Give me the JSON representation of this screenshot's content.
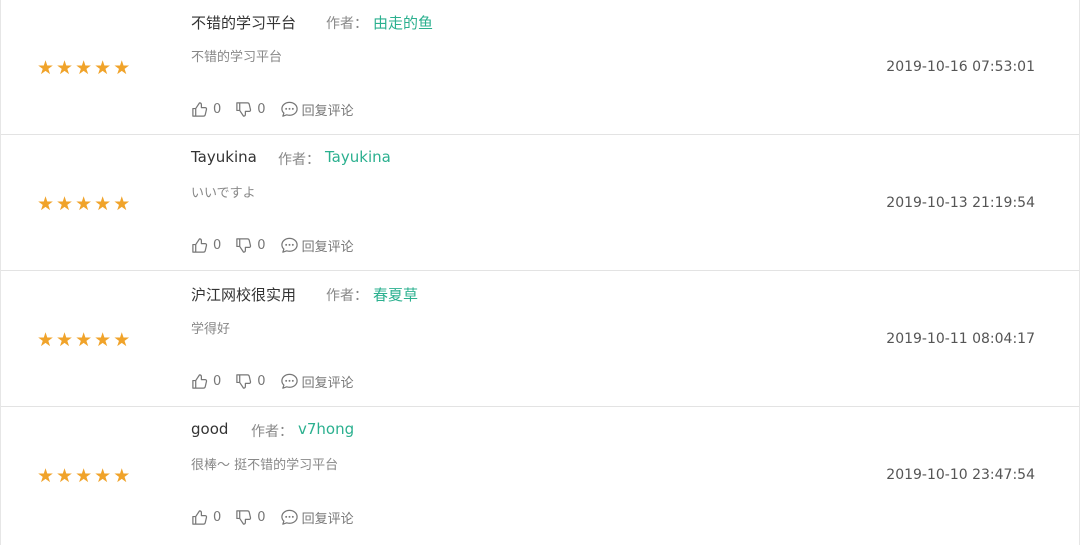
{
  "reviews": [
    {
      "title": "不错的学习平台",
      "author_label": "作者：",
      "author": "由走的鱼",
      "content": "不错的学习平台",
      "date": "2019-10-16 07:53:01",
      "stars": 5,
      "likes": "0",
      "dislikes": "0",
      "reply_label": "回复评论"
    },
    {
      "title": "Tayukina",
      "author_label": "作者：",
      "author": "Tayukina",
      "content": "いいですよ",
      "date": "2019-10-13 21:19:54",
      "stars": 5,
      "likes": "0",
      "dislikes": "0",
      "reply_label": "回复评论"
    },
    {
      "title": "沪江网校很实用",
      "author_label": "作者：",
      "author": "春夏草",
      "content": "学得好",
      "date": "2019-10-11 08:04:17",
      "stars": 5,
      "likes": "0",
      "dislikes": "0",
      "reply_label": "回复评论"
    },
    {
      "title": "good",
      "author_label": "作者：",
      "author": "v7hong",
      "content": "很棒～ 挺不错的学习平台",
      "date": "2019-10-10 23:47:54",
      "stars": 5,
      "likes": "0",
      "dislikes": "0",
      "reply_label": "回复评论"
    }
  ],
  "colors": {
    "star": "#f0a32a",
    "author_link": "#2bb08f",
    "divider": "#e3e3e3"
  },
  "icons": {
    "like": "thumbs-up-icon",
    "dislike": "thumbs-down-icon",
    "reply": "comment-bubble-icon"
  }
}
